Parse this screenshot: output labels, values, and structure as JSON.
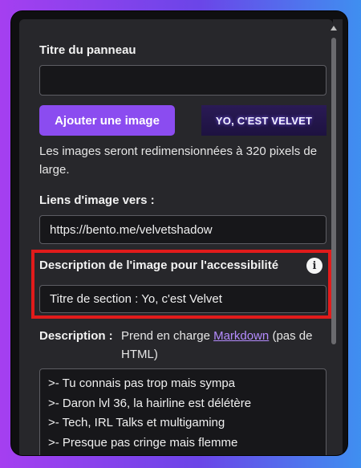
{
  "panel": {
    "title_label": "Titre du panneau",
    "title_value": "",
    "add_image_label": "Ajouter une image",
    "banner_text": "YO, C'EST VELVET",
    "resize_hint": "Les images seront redimensionnées à 320 pixels de large.",
    "link_label": "Liens d'image vers :",
    "link_value": "https://bento.me/velvetshadow",
    "alt_label": "Description de l'image pour l'accessibilité",
    "alt_value": "Titre de section : Yo, c'est Velvet",
    "description_label": "Description :",
    "description_hint_prefix": "Prend en charge ",
    "description_hint_link": "Markdown",
    "description_hint_suffix": " (pas de HTML)",
    "description_lines": [
      ">- Tu connais pas trop mais sympa",
      ">- Daron lvl 36, la hairline est délétère",
      ">- Tech, IRL Talks et multigaming",
      ">- Presque pas cringe mais flemme"
    ]
  },
  "colors": {
    "accent": "#8b4cf0",
    "highlight_border": "#e11b1b",
    "panel_bg": "#27272b"
  },
  "icons": {
    "info": "info-icon",
    "scroll_up": "scroll-up-icon"
  }
}
